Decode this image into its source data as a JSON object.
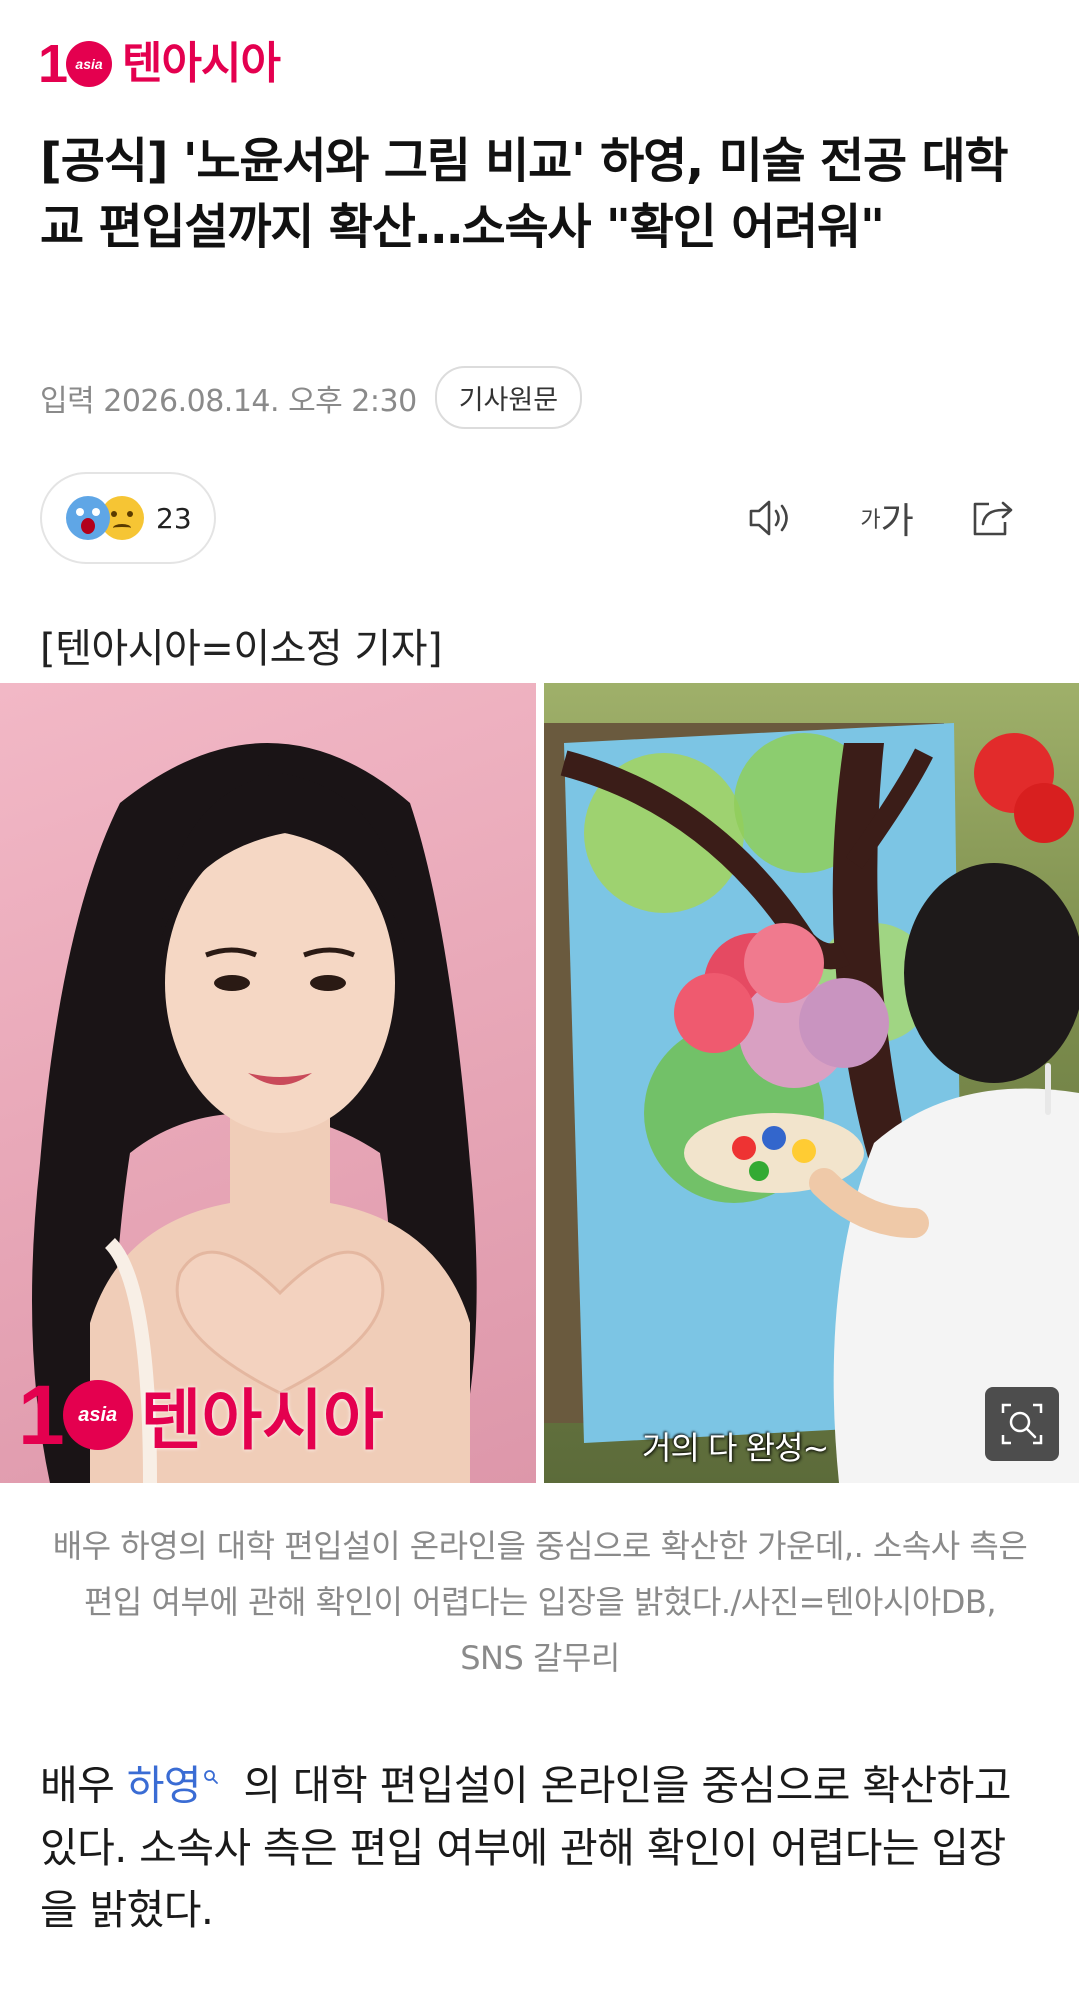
{
  "brand": {
    "logo_number": "10",
    "logo_small": "asia",
    "logo_text": "텐아시아",
    "accent_color": "#e4004f"
  },
  "article": {
    "headline": "[공식] '노윤서와 그림 비교' 하영, 미술 전공 대학교 편입설까지 확산…소속사 \"확인 어려워\"",
    "date": "입력 2026.08.14. 오후 2:30",
    "original_button": "기사원문",
    "reaction_count": "23",
    "reaction_icons": [
      "shocked-emoji",
      "sad-emoji"
    ],
    "tool_icons": [
      "speaker-icon",
      "font-size-icon",
      "share-icon"
    ],
    "font_size_small": "가",
    "font_size_large": "가",
    "byline": "[텐아시아=이소정 기자]",
    "photo_subtitle": "거의 다 완성~",
    "caption": "배우 하영의 대학 편입설이 온라인을 중심으로 확산한 가운데,. 소속사 측은 편입 여부에 관해 확인이 어렵다는 입장을 밝혔다./사진=텐아시아DB, SNS 갈무리",
    "body_prefix": "배우 ",
    "body_link": "하영",
    "body_rest": " 의 대학 편입설이 온라인을 중심으로 확산하고 있다. 소속사 측은 편입 여부에 관해 확인이 어렵다는 입장을 밝혔다."
  }
}
